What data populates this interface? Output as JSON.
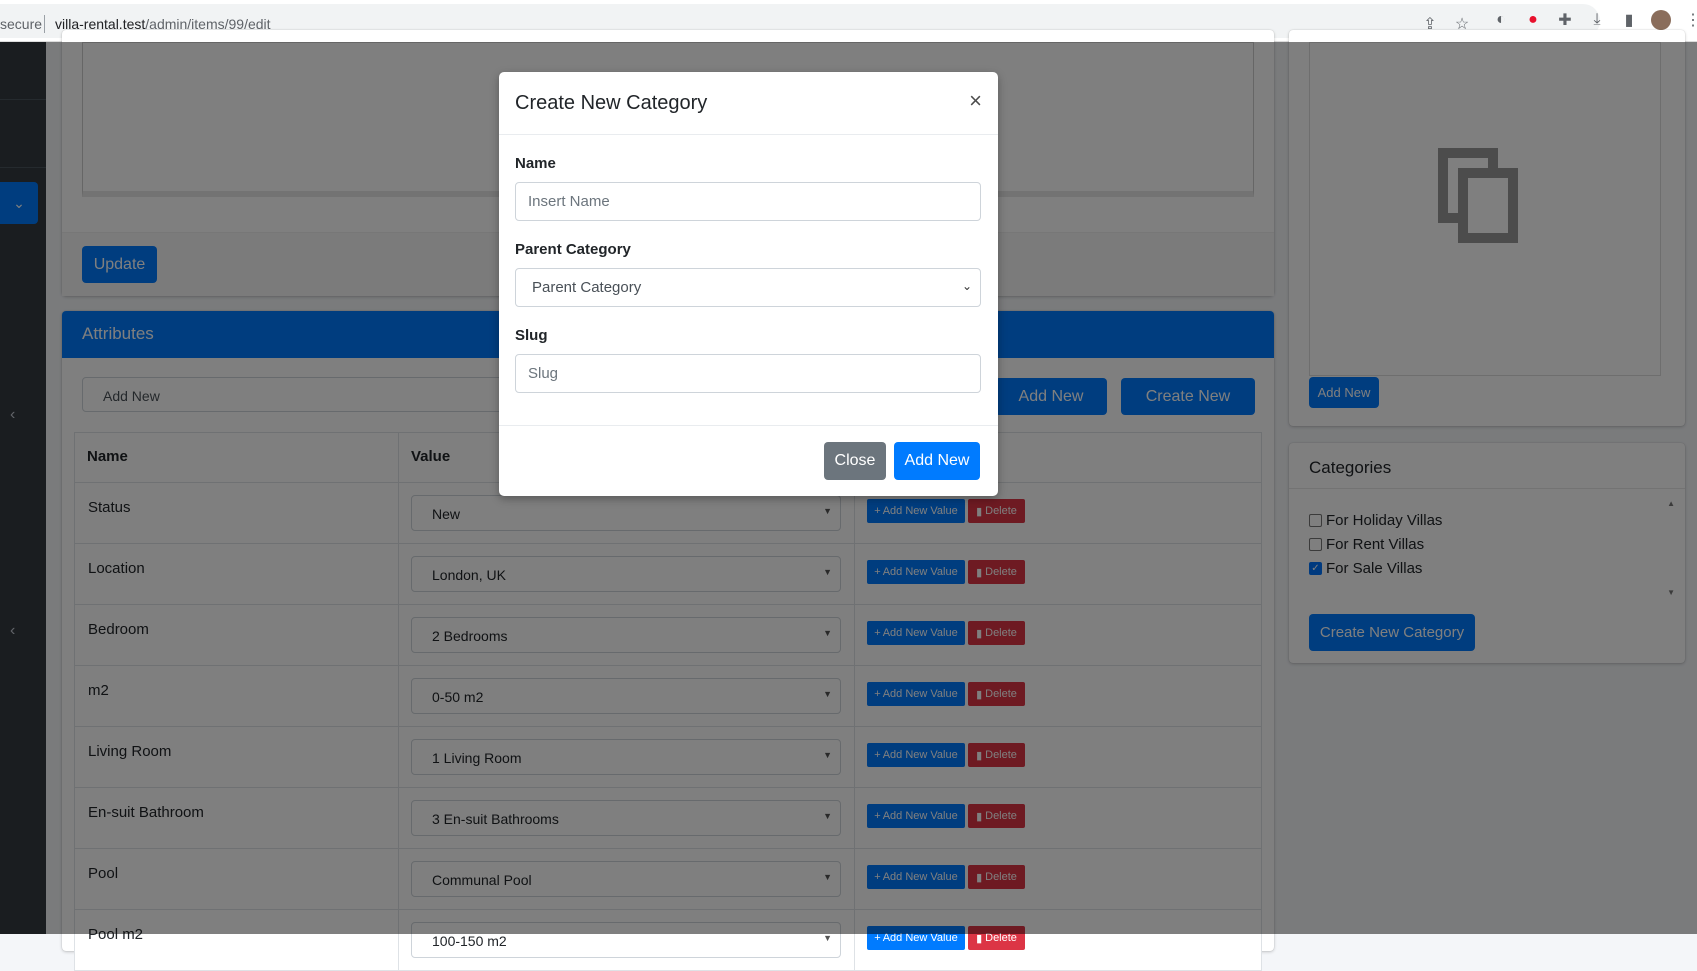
{
  "browser": {
    "secure_label": "secure",
    "url_host": "villa-rental.test",
    "url_path": "/admin/items/99/edit"
  },
  "colors": {
    "primary": "#007bff",
    "danger": "#dc3545",
    "secondary": "#6c757d",
    "sidebar": "#343a40"
  },
  "editor": {
    "update_label": "Update"
  },
  "attributes": {
    "title": "Attributes",
    "add_new_placeholder": "Add New",
    "add_new_label": "Add New",
    "create_new_label": "Create New",
    "columns": [
      "Name",
      "Value"
    ],
    "add_value_label": "Add New Value",
    "delete_label": "Delete",
    "rows": [
      {
        "name": "Status",
        "value": "New"
      },
      {
        "name": "Location",
        "value": "London, UK"
      },
      {
        "name": "Bedroom",
        "value": "2 Bedrooms"
      },
      {
        "name": "m2",
        "value": "0-50 m2"
      },
      {
        "name": "Living Room",
        "value": "1 Living Room"
      },
      {
        "name": "En-suit Bathroom",
        "value": "3 En-suit Bathrooms"
      },
      {
        "name": "Pool",
        "value": "Communal Pool"
      },
      {
        "name": "Pool m2",
        "value": "100-150 m2"
      }
    ]
  },
  "image_card": {
    "add_new_label": "Add New"
  },
  "categories": {
    "title": "Categories",
    "items": [
      {
        "label": "For Holiday Villas",
        "checked": false
      },
      {
        "label": "For Rent Villas",
        "checked": false
      },
      {
        "label": "For Sale Villas",
        "checked": true
      }
    ],
    "create_label": "Create New Category"
  },
  "modal": {
    "title": "Create New Category",
    "close_icon": "×",
    "name_label": "Name",
    "name_placeholder": "Insert Name",
    "parent_label": "Parent Category",
    "parent_selected": "Parent Category",
    "slug_label": "Slug",
    "slug_placeholder": "Slug",
    "close_label": "Close",
    "submit_label": "Add New"
  }
}
